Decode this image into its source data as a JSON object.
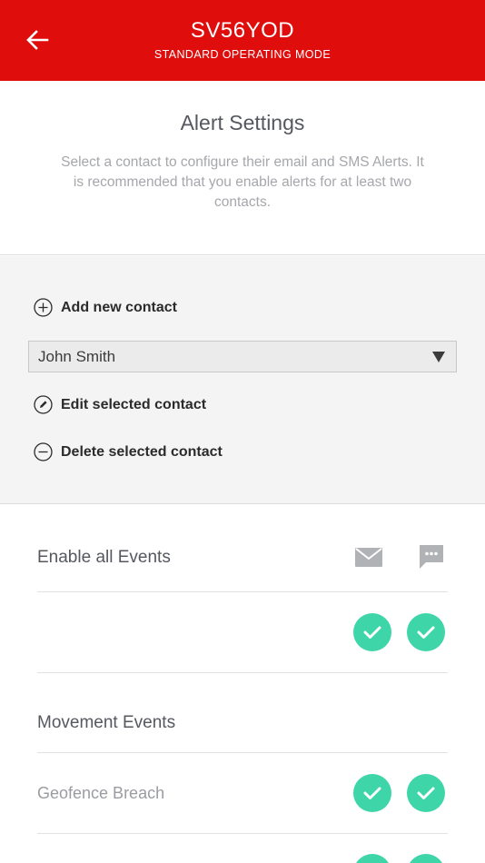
{
  "header": {
    "title": "SV56YOD",
    "subtitle": "STANDARD OPERATING MODE",
    "back_icon": "arrow-left-icon"
  },
  "intro": {
    "title": "Alert Settings",
    "description": "Select a contact to configure their email and SMS Alerts. It is recommended that you enable alerts for at least two contacts."
  },
  "contacts": {
    "add_label": "Add new contact",
    "selected_contact": "John Smith",
    "edit_label": "Edit selected contact",
    "delete_label": "Delete selected contact"
  },
  "events": {
    "enable_all_label": "Enable all Events",
    "columns": [
      "email-icon",
      "sms-icon"
    ],
    "enable_all": {
      "email": true,
      "sms": true
    },
    "sections": [
      {
        "title": "Movement Events",
        "items": [
          {
            "label": "Geofence Breach",
            "email": true,
            "sms": true
          }
        ]
      }
    ]
  },
  "colors": {
    "header_red": "#e00d0d",
    "check_green": "#3ed6a8",
    "heading_gray": "#55585e",
    "icon_gray": "#b0b2b6"
  }
}
